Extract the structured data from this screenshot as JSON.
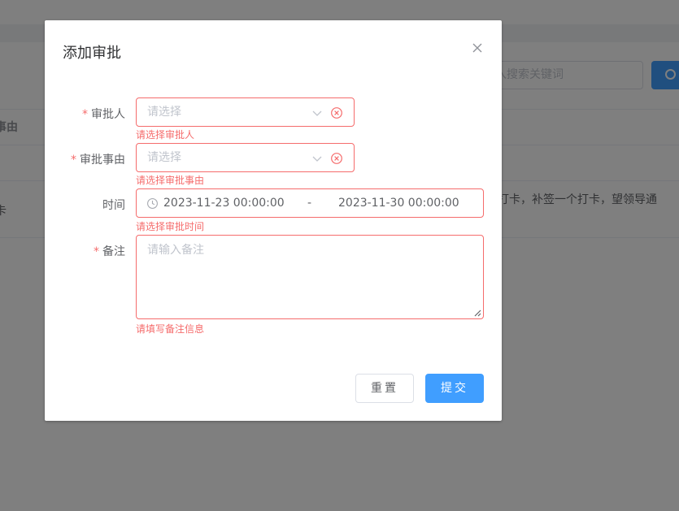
{
  "background": {
    "search_placeholder": "入搜索关键词",
    "table_header_fragment": "事由",
    "row_left_fragment": "卡",
    "row_reason_fragment": "打卡，补签一个打卡，望领导通"
  },
  "dialog": {
    "title": "添加审批",
    "close_icon": "close-icon",
    "fields": {
      "approver": {
        "label": "审批人",
        "required": "*",
        "placeholder": "请选择",
        "error": "请选择审批人"
      },
      "reason": {
        "label": "审批事由",
        "required": "*",
        "placeholder": "请选择",
        "error": "请选择审批事由"
      },
      "time": {
        "label": "时间",
        "start": "2023-11-23 00:00:00",
        "separator": "-",
        "end": "2023-11-30 00:00:00",
        "error": "请选择审批时间"
      },
      "remark": {
        "label": "备注",
        "required": "*",
        "placeholder": "请输入备注",
        "error": "请填写备注信息"
      }
    },
    "buttons": {
      "reset": "重置",
      "submit": "提交"
    }
  },
  "colors": {
    "error": "#f56c6c",
    "primary": "#409eff",
    "annotation": "#e6262e"
  }
}
